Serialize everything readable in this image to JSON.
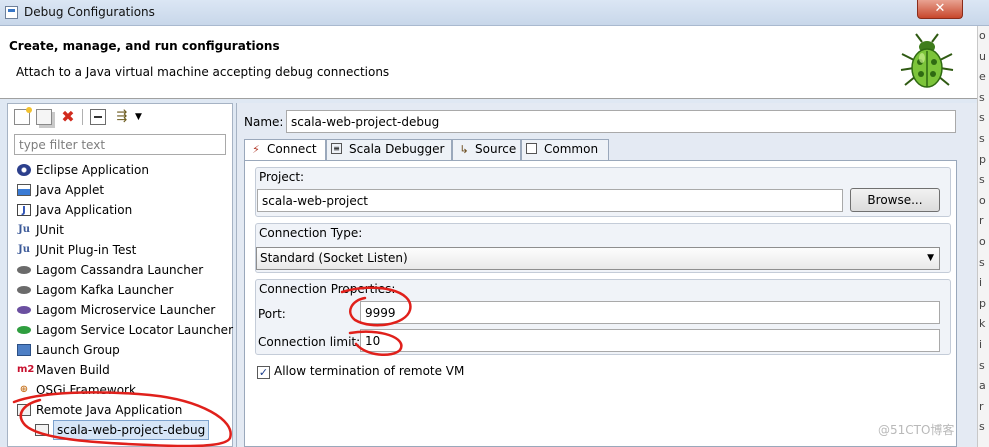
{
  "window": {
    "title": "Debug Configurations",
    "close_icon": "close-icon"
  },
  "header": {
    "title": "Create, manage, and run configurations",
    "description": "Attach to a Java virtual machine accepting debug connections",
    "icon": "bug-icon"
  },
  "left": {
    "toolbar_icons": [
      "new-configuration-icon",
      "duplicate-icon",
      "delete-icon",
      "collapse-all-icon",
      "filter-icon",
      "view-menu-icon"
    ],
    "filter_placeholder": "type filter text",
    "items": [
      {
        "label": "Eclipse Application",
        "icon": "eclipse-icon"
      },
      {
        "label": "Java Applet",
        "icon": "applet-icon"
      },
      {
        "label": "Java Application",
        "icon": "java-app-icon"
      },
      {
        "label": "JUnit",
        "icon": "junit-icon"
      },
      {
        "label": "JUnit Plug-in Test",
        "icon": "junit-plugin-icon"
      },
      {
        "label": "Lagom Cassandra Launcher",
        "icon": "lagom-icon"
      },
      {
        "label": "Lagom Kafka Launcher",
        "icon": "lagom-icon"
      },
      {
        "label": "Lagom Microservice Launcher",
        "icon": "lagom-icon"
      },
      {
        "label": "Lagom Service Locator Launcher",
        "icon": "lagom-icon"
      },
      {
        "label": "Launch Group",
        "icon": "launch-group-icon"
      },
      {
        "label": "Maven Build",
        "icon": "maven-icon"
      },
      {
        "label": "OSGi Framework",
        "icon": "osgi-icon"
      },
      {
        "label": "Remote Java Application",
        "icon": "remote-java-icon"
      }
    ],
    "child": {
      "label": "scala-web-project-debug",
      "icon": "remote-config-icon"
    },
    "icon_text": {
      "junit": "Ju",
      "maven": "m2",
      "osgi": "⊕",
      "java": "J"
    }
  },
  "right": {
    "name_label": "Name:",
    "name_value": "scala-web-project-debug",
    "tabs": [
      {
        "label": "Connect",
        "icon": "connect-icon"
      },
      {
        "label": "Scala Debugger",
        "icon": "scala-debugger-icon"
      },
      {
        "label": "Source",
        "icon": "source-icon"
      },
      {
        "label": "Common",
        "icon": "common-icon"
      }
    ],
    "project": {
      "label": "Project:",
      "value": "scala-web-project",
      "browse": "Browse..."
    },
    "connection_type": {
      "label": "Connection Type:",
      "value": "Standard (Socket Listen)"
    },
    "connection_properties": {
      "label": "Connection Properties:",
      "port_label": "Port:",
      "port_value": "9999",
      "limit_label": "Connection limit:",
      "limit_value": "10"
    },
    "allow_termination": {
      "label": "Allow termination of remote VM",
      "checked": true
    }
  },
  "watermark": "@51CTO博客",
  "annotation_color": "#e0201b"
}
